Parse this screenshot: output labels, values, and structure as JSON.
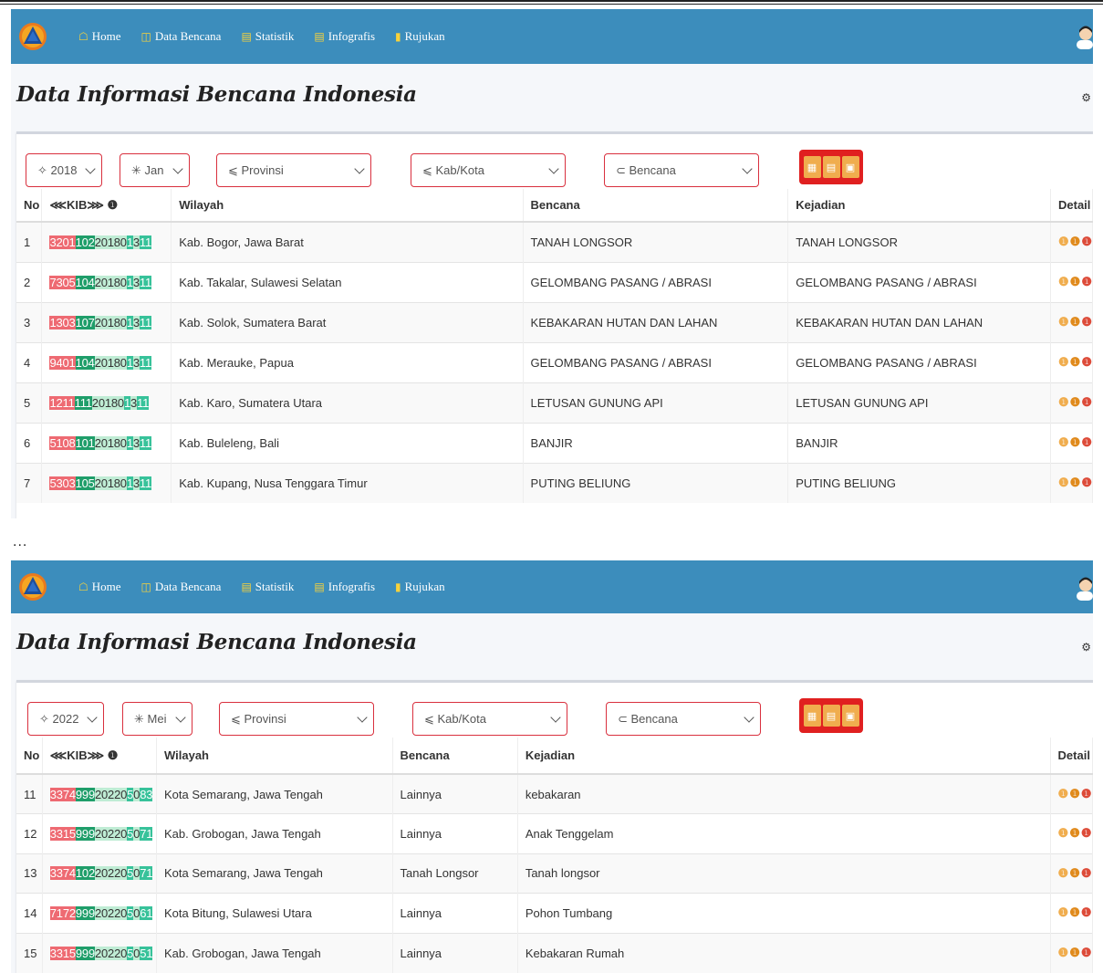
{
  "nav": {
    "items": [
      {
        "id": "home",
        "label": "Home",
        "icon": "home-icon"
      },
      {
        "id": "data",
        "label": "Data Bencana",
        "icon": "database-icon"
      },
      {
        "id": "stat",
        "label": "Statistik",
        "icon": "bar-chart-icon"
      },
      {
        "id": "info",
        "label": "Infografis",
        "icon": "bar-chart-icon"
      },
      {
        "id": "ref",
        "label": "Rujukan",
        "icon": "book-icon"
      }
    ]
  },
  "page_title": "Data Informasi Bencana Indonesia",
  "ellipsis": "...",
  "headers": {
    "no": "No",
    "kib": "⋘KIB⋙ ❶",
    "wilayah": "Wilayah",
    "bencana": "Bencana",
    "kejadian": "Kejadian",
    "detail": "Detail"
  },
  "detail_icons": [
    "❶",
    "❶",
    "❶"
  ],
  "shot1": {
    "filters": {
      "year": "✧ 2018",
      "month": "✳ Jan",
      "provinsi": "⩽ Provinsi",
      "kabkota": "⩽ Kab/Kota",
      "bencana": "⊂ Bencana"
    },
    "rows": [
      {
        "no": "1",
        "kib": [
          "3201",
          "102",
          "20180",
          "1",
          "3",
          "11"
        ],
        "wilayah": "Kab. Bogor, Jawa Barat",
        "bencana": "TANAH LONGSOR",
        "kejadian": "TANAH LONGSOR"
      },
      {
        "no": "2",
        "kib": [
          "7305",
          "104",
          "20180",
          "1",
          "3",
          "11"
        ],
        "wilayah": "Kab. Takalar, Sulawesi Selatan",
        "bencana": "GELOMBANG PASANG / ABRASI",
        "kejadian": "GELOMBANG PASANG / ABRASI"
      },
      {
        "no": "3",
        "kib": [
          "1303",
          "107",
          "20180",
          "1",
          "3",
          "11"
        ],
        "wilayah": "Kab. Solok, Sumatera Barat",
        "bencana": "KEBAKARAN HUTAN DAN LAHAN",
        "kejadian": "KEBAKARAN HUTAN DAN LAHAN"
      },
      {
        "no": "4",
        "kib": [
          "9401",
          "104",
          "20180",
          "1",
          "3",
          "11"
        ],
        "wilayah": "Kab. Merauke, Papua",
        "bencana": "GELOMBANG PASANG / ABRASI",
        "kejadian": "GELOMBANG PASANG / ABRASI"
      },
      {
        "no": "5",
        "kib": [
          "1211",
          "111",
          "20180",
          "1",
          "3",
          "11"
        ],
        "wilayah": "Kab. Karo, Sumatera Utara",
        "bencana": "LETUSAN GUNUNG API",
        "kejadian": "LETUSAN GUNUNG API"
      },
      {
        "no": "6",
        "kib": [
          "5108",
          "101",
          "20180",
          "1",
          "3",
          "11"
        ],
        "wilayah": "Kab. Buleleng, Bali",
        "bencana": "BANJIR",
        "kejadian": "BANJIR"
      },
      {
        "no": "7",
        "kib": [
          "5303",
          "105",
          "20180",
          "1",
          "3",
          "11"
        ],
        "wilayah": "Kab. Kupang, Nusa Tenggara Timur",
        "bencana": "PUTING BELIUNG",
        "kejadian": "PUTING BELIUNG"
      }
    ]
  },
  "shot2": {
    "filters": {
      "year": "✧ 2022",
      "month": "✳ Mei",
      "provinsi": "⩽ Provinsi",
      "kabkota": "⩽ Kab/Kota",
      "bencana": "⊂ Bencana"
    },
    "rows": [
      {
        "no": "11",
        "kib": [
          "3374",
          "999",
          "20220",
          "5",
          "0",
          "83"
        ],
        "wilayah": "Kota Semarang, Jawa Tengah",
        "bencana": "Lainnya",
        "kejadian": "kebakaran"
      },
      {
        "no": "12",
        "kib": [
          "3315",
          "999",
          "20220",
          "5",
          "0",
          "71"
        ],
        "wilayah": "Kab. Grobogan, Jawa Tengah",
        "bencana": "Lainnya",
        "kejadian": "Anak Tenggelam"
      },
      {
        "no": "13",
        "kib": [
          "3374",
          "102",
          "20220",
          "5",
          "0",
          "71"
        ],
        "wilayah": "Kota Semarang, Jawa Tengah",
        "bencana": "Tanah Longsor",
        "kejadian": "Tanah longsor"
      },
      {
        "no": "14",
        "kib": [
          "7172",
          "999",
          "20220",
          "5",
          "0",
          "61"
        ],
        "wilayah": "Kota Bitung, Sulawesi Utara",
        "bencana": "Lainnya",
        "kejadian": "Pohon Tumbang"
      },
      {
        "no": "15",
        "kib": [
          "3315",
          "999",
          "20220",
          "5",
          "0",
          "51"
        ],
        "wilayah": "Kab. Grobogan, Jawa Tengah",
        "bencana": "Lainnya",
        "kejadian": "Kebakaran Rumah"
      }
    ]
  }
}
